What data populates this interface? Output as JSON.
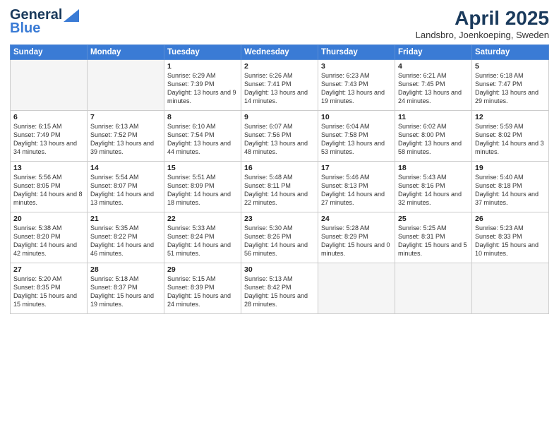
{
  "header": {
    "logo_general": "General",
    "logo_blue": "Blue",
    "title": "April 2025",
    "subtitle": "Landsbro, Joenkoeping, Sweden"
  },
  "weekdays": [
    "Sunday",
    "Monday",
    "Tuesday",
    "Wednesday",
    "Thursday",
    "Friday",
    "Saturday"
  ],
  "weeks": [
    [
      {
        "day": "",
        "sunrise": "",
        "sunset": "",
        "daylight": ""
      },
      {
        "day": "",
        "sunrise": "",
        "sunset": "",
        "daylight": ""
      },
      {
        "day": "1",
        "sunrise": "Sunrise: 6:29 AM",
        "sunset": "Sunset: 7:39 PM",
        "daylight": "Daylight: 13 hours and 9 minutes."
      },
      {
        "day": "2",
        "sunrise": "Sunrise: 6:26 AM",
        "sunset": "Sunset: 7:41 PM",
        "daylight": "Daylight: 13 hours and 14 minutes."
      },
      {
        "day": "3",
        "sunrise": "Sunrise: 6:23 AM",
        "sunset": "Sunset: 7:43 PM",
        "daylight": "Daylight: 13 hours and 19 minutes."
      },
      {
        "day": "4",
        "sunrise": "Sunrise: 6:21 AM",
        "sunset": "Sunset: 7:45 PM",
        "daylight": "Daylight: 13 hours and 24 minutes."
      },
      {
        "day": "5",
        "sunrise": "Sunrise: 6:18 AM",
        "sunset": "Sunset: 7:47 PM",
        "daylight": "Daylight: 13 hours and 29 minutes."
      }
    ],
    [
      {
        "day": "6",
        "sunrise": "Sunrise: 6:15 AM",
        "sunset": "Sunset: 7:49 PM",
        "daylight": "Daylight: 13 hours and 34 minutes."
      },
      {
        "day": "7",
        "sunrise": "Sunrise: 6:13 AM",
        "sunset": "Sunset: 7:52 PM",
        "daylight": "Daylight: 13 hours and 39 minutes."
      },
      {
        "day": "8",
        "sunrise": "Sunrise: 6:10 AM",
        "sunset": "Sunset: 7:54 PM",
        "daylight": "Daylight: 13 hours and 44 minutes."
      },
      {
        "day": "9",
        "sunrise": "Sunrise: 6:07 AM",
        "sunset": "Sunset: 7:56 PM",
        "daylight": "Daylight: 13 hours and 48 minutes."
      },
      {
        "day": "10",
        "sunrise": "Sunrise: 6:04 AM",
        "sunset": "Sunset: 7:58 PM",
        "daylight": "Daylight: 13 hours and 53 minutes."
      },
      {
        "day": "11",
        "sunrise": "Sunrise: 6:02 AM",
        "sunset": "Sunset: 8:00 PM",
        "daylight": "Daylight: 13 hours and 58 minutes."
      },
      {
        "day": "12",
        "sunrise": "Sunrise: 5:59 AM",
        "sunset": "Sunset: 8:02 PM",
        "daylight": "Daylight: 14 hours and 3 minutes."
      }
    ],
    [
      {
        "day": "13",
        "sunrise": "Sunrise: 5:56 AM",
        "sunset": "Sunset: 8:05 PM",
        "daylight": "Daylight: 14 hours and 8 minutes."
      },
      {
        "day": "14",
        "sunrise": "Sunrise: 5:54 AM",
        "sunset": "Sunset: 8:07 PM",
        "daylight": "Daylight: 14 hours and 13 minutes."
      },
      {
        "day": "15",
        "sunrise": "Sunrise: 5:51 AM",
        "sunset": "Sunset: 8:09 PM",
        "daylight": "Daylight: 14 hours and 18 minutes."
      },
      {
        "day": "16",
        "sunrise": "Sunrise: 5:48 AM",
        "sunset": "Sunset: 8:11 PM",
        "daylight": "Daylight: 14 hours and 22 minutes."
      },
      {
        "day": "17",
        "sunrise": "Sunrise: 5:46 AM",
        "sunset": "Sunset: 8:13 PM",
        "daylight": "Daylight: 14 hours and 27 minutes."
      },
      {
        "day": "18",
        "sunrise": "Sunrise: 5:43 AM",
        "sunset": "Sunset: 8:16 PM",
        "daylight": "Daylight: 14 hours and 32 minutes."
      },
      {
        "day": "19",
        "sunrise": "Sunrise: 5:40 AM",
        "sunset": "Sunset: 8:18 PM",
        "daylight": "Daylight: 14 hours and 37 minutes."
      }
    ],
    [
      {
        "day": "20",
        "sunrise": "Sunrise: 5:38 AM",
        "sunset": "Sunset: 8:20 PM",
        "daylight": "Daylight: 14 hours and 42 minutes."
      },
      {
        "day": "21",
        "sunrise": "Sunrise: 5:35 AM",
        "sunset": "Sunset: 8:22 PM",
        "daylight": "Daylight: 14 hours and 46 minutes."
      },
      {
        "day": "22",
        "sunrise": "Sunrise: 5:33 AM",
        "sunset": "Sunset: 8:24 PM",
        "daylight": "Daylight: 14 hours and 51 minutes."
      },
      {
        "day": "23",
        "sunrise": "Sunrise: 5:30 AM",
        "sunset": "Sunset: 8:26 PM",
        "daylight": "Daylight: 14 hours and 56 minutes."
      },
      {
        "day": "24",
        "sunrise": "Sunrise: 5:28 AM",
        "sunset": "Sunset: 8:29 PM",
        "daylight": "Daylight: 15 hours and 0 minutes."
      },
      {
        "day": "25",
        "sunrise": "Sunrise: 5:25 AM",
        "sunset": "Sunset: 8:31 PM",
        "daylight": "Daylight: 15 hours and 5 minutes."
      },
      {
        "day": "26",
        "sunrise": "Sunrise: 5:23 AM",
        "sunset": "Sunset: 8:33 PM",
        "daylight": "Daylight: 15 hours and 10 minutes."
      }
    ],
    [
      {
        "day": "27",
        "sunrise": "Sunrise: 5:20 AM",
        "sunset": "Sunset: 8:35 PM",
        "daylight": "Daylight: 15 hours and 15 minutes."
      },
      {
        "day": "28",
        "sunrise": "Sunrise: 5:18 AM",
        "sunset": "Sunset: 8:37 PM",
        "daylight": "Daylight: 15 hours and 19 minutes."
      },
      {
        "day": "29",
        "sunrise": "Sunrise: 5:15 AM",
        "sunset": "Sunset: 8:39 PM",
        "daylight": "Daylight: 15 hours and 24 minutes."
      },
      {
        "day": "30",
        "sunrise": "Sunrise: 5:13 AM",
        "sunset": "Sunset: 8:42 PM",
        "daylight": "Daylight: 15 hours and 28 minutes."
      },
      {
        "day": "",
        "sunrise": "",
        "sunset": "",
        "daylight": ""
      },
      {
        "day": "",
        "sunrise": "",
        "sunset": "",
        "daylight": ""
      },
      {
        "day": "",
        "sunrise": "",
        "sunset": "",
        "daylight": ""
      }
    ]
  ]
}
